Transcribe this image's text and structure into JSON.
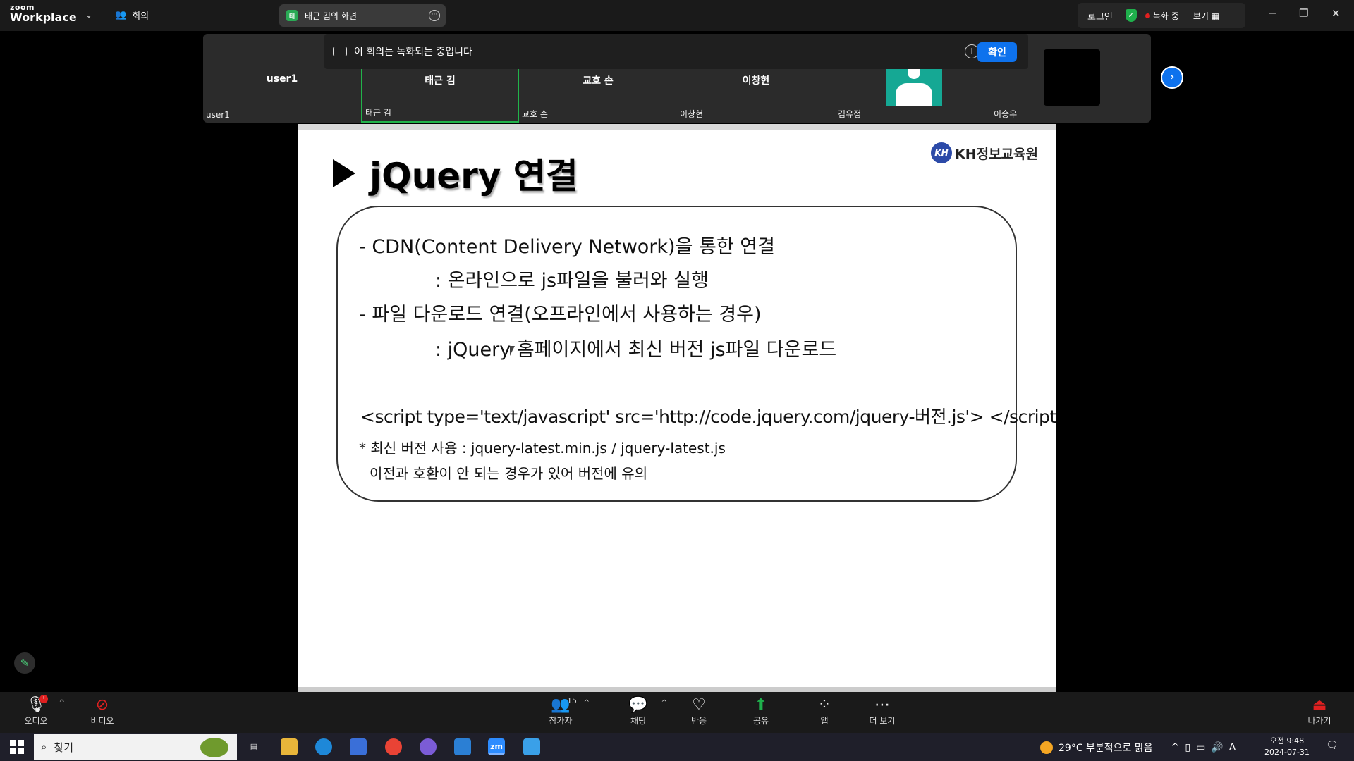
{
  "zoom": {
    "logo_top": "zoom",
    "logo_bottom": "Workplace",
    "meeting_label": "회의",
    "share_tab": "태근 김의 화면",
    "login": "로그인",
    "recording": "녹화 중",
    "view": "보기"
  },
  "banner": {
    "text": "이 회의는 녹화되는 중입니다",
    "ok": "확인"
  },
  "participants": [
    {
      "name": "user1",
      "label": "user1"
    },
    {
      "name": "태근 김",
      "label": "태근 김"
    },
    {
      "name": "교호 손",
      "label": "교호 손"
    },
    {
      "name": "이창현",
      "label": "이창현"
    },
    {
      "name": "",
      "label": "김유정"
    },
    {
      "name": "",
      "label": "이승우"
    }
  ],
  "slide": {
    "title": "jQuery 연결",
    "logo_mark": "KH",
    "logo_text": "KH정보교육원",
    "line1": "- CDN(Content Delivery Network)을 통한 연결",
    "line2": ": 온라인으로 js파일을 불러와 실행",
    "line3": "- 파일 다운로드 연결(오프라인에서 사용하는 경우)",
    "line4": ": jQuery 홈페이지에서 최신 버전 js파일 다운로드",
    "code": "<script type='text/javascript' src='http://code.jquery.com/jquery-버전.js'> </script>",
    "note1": "* 최신 버전 사용 : jquery-latest.min.js / jquery-latest.js",
    "note2": "이전과 호환이 안 되는 경우가 있어 버전에 유의"
  },
  "toolbar": {
    "audio": "오디오",
    "video": "비디오",
    "participants": "참가자",
    "participant_count": "15",
    "chat": "채팅",
    "reactions": "반응",
    "share": "공유",
    "apps": "앱",
    "more": "더 보기",
    "leave": "나가기"
  },
  "taskbar": {
    "search": "찾기",
    "weather": "29°C 부분적으로 맑음",
    "ime": "A",
    "time": "오전 9:48",
    "date": "2024-07-31"
  },
  "colors": {
    "zoom_blue": "#0e72ed",
    "active_green": "#21b34a",
    "record_red": "#e02020",
    "share_green": "#1fb04c"
  }
}
